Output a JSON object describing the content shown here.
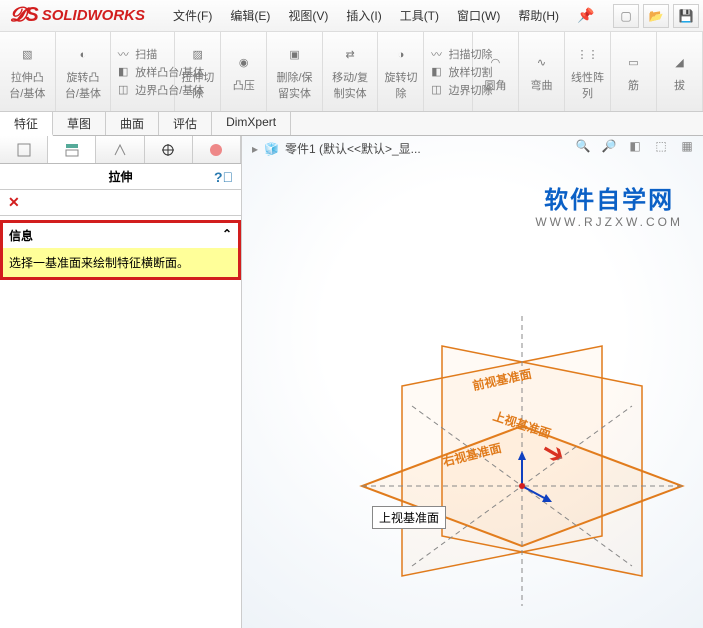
{
  "app": {
    "logo_text": "SOLIDWORKS"
  },
  "menus": [
    "文件(F)",
    "编辑(E)",
    "视图(V)",
    "插入(I)",
    "工具(T)",
    "窗口(W)",
    "帮助(H)"
  ],
  "ribbon": {
    "large": [
      {
        "label": "拉伸凸台/基体"
      },
      {
        "label": "旋转凸台/基体"
      }
    ],
    "sweep_group": [
      "扫描",
      "放样凸台/基体",
      "边界凸台/基体"
    ],
    "large2": [
      {
        "label": "拉伸切除"
      },
      {
        "label": "凸压",
        "sub": ""
      },
      {
        "label": "删除/保留实体"
      },
      {
        "label": "移动/复制实体"
      },
      {
        "label": "旋转切除"
      }
    ],
    "cut_group": [
      "扫描切除",
      "放样切割",
      "边界切除"
    ],
    "large3": [
      {
        "label": "圆角"
      },
      {
        "label": "弯曲"
      },
      {
        "label": "线性阵列"
      },
      {
        "label": "筋"
      },
      {
        "label": "拔"
      }
    ]
  },
  "tabs": [
    "特征",
    "草图",
    "曲面",
    "评估",
    "DimXpert"
  ],
  "panel": {
    "title": "拉伸",
    "info_head": "信息",
    "info_body": "选择一基准面来绘制特征横断面。"
  },
  "breadcrumb": {
    "part": "零件1 (默认<<默认>_显..."
  },
  "planes": {
    "front": "前视基准面",
    "top": "上视基准面",
    "right": "右视基准面",
    "tooltip": "上视基准面"
  },
  "watermark": {
    "cn": "软件自学网",
    "url": "WWW.RJZXW.COM"
  },
  "colors": {
    "accent": "#e07b1c",
    "red": "#d21e1e",
    "blue": "#0b60c6"
  }
}
